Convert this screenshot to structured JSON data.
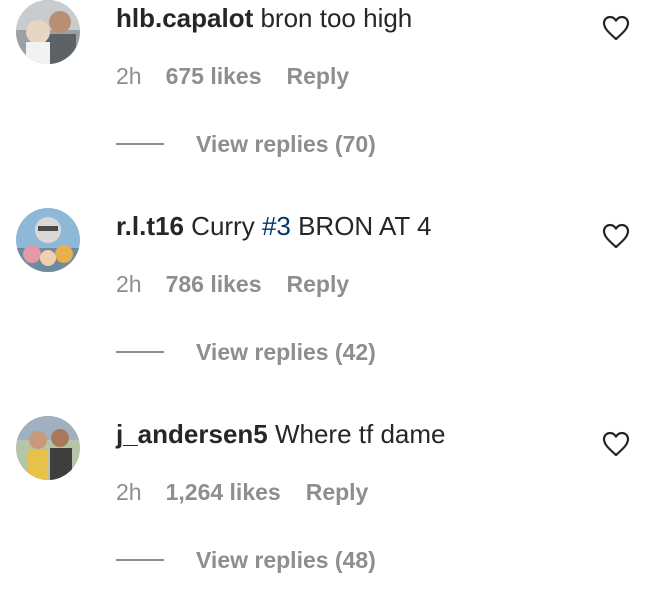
{
  "comments": [
    {
      "username": "hlb.capalot",
      "text": " bron too high",
      "text_before_hashtag": "",
      "hashtag": "",
      "text_after_hashtag": "",
      "time": "2h",
      "likes": "675 likes",
      "reply_label": "Reply",
      "view_replies": "View replies (70)",
      "avatar_icon": "avatar-photo-icon",
      "like_icon": "heart-outline-icon"
    },
    {
      "username": "r.l.t16",
      "text": "",
      "text_before_hashtag": " Curry ",
      "hashtag": "#3",
      "text_after_hashtag": " BRON AT 4",
      "time": "2h",
      "likes": "786 likes",
      "reply_label": "Reply",
      "view_replies": "View replies (42)",
      "avatar_icon": "avatar-photo-icon",
      "like_icon": "heart-outline-icon"
    },
    {
      "username": "j_andersen5",
      "text": " Where tf dame",
      "text_before_hashtag": "",
      "hashtag": "",
      "text_after_hashtag": "",
      "time": "2h",
      "likes": "1,264 likes",
      "reply_label": "Reply",
      "view_replies": "View replies (48)",
      "avatar_icon": "avatar-photo-icon",
      "like_icon": "heart-outline-icon"
    }
  ],
  "colors": {
    "text": "#262626",
    "secondary": "#8e8e8e",
    "hashtag": "#00376b"
  }
}
